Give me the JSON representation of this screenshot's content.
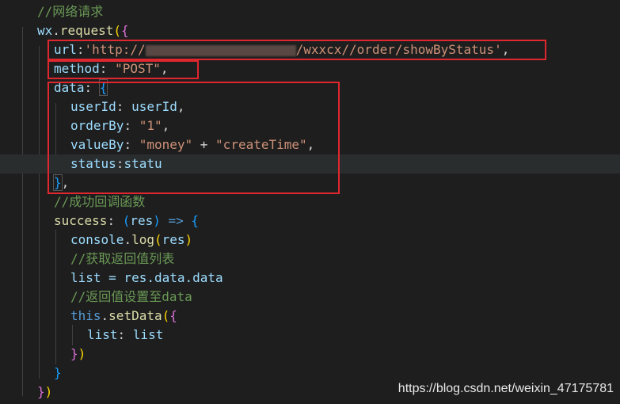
{
  "code": {
    "l1_comment": "//网络请求",
    "l2_obj": "wx",
    "l2_dot": ".",
    "l2_fn": "request",
    "l2_open": "(",
    "l2_brace": "{",
    "l3_key": "url",
    "l3_colon": ":",
    "l3_str_a": "'http://",
    "l3_str_b": "/wxxcx//order/showByStatus'",
    "l3_comma": ",",
    "l4_key": "method",
    "l4_colon": ": ",
    "l4_str": "\"POST\"",
    "l4_comma": ",",
    "l5_key": "data",
    "l5_colon": ": ",
    "l5_brace": "{",
    "l6_key": "userId",
    "l6_colon": ": ",
    "l6_val": "userId",
    "l6_comma": ",",
    "l7_key": "orderBy",
    "l7_colon": ": ",
    "l7_str": "\"1\"",
    "l7_comma": ",",
    "l8_key": "valueBy",
    "l8_colon": ": ",
    "l8_str_a": "\"money\"",
    "l8_plus": " + ",
    "l8_str_b": "\"createTime\"",
    "l8_comma": ",",
    "l9_key": "status",
    "l9_colon": ":",
    "l9_val": "statu",
    "l10_brace": "}",
    "l10_comma": ",",
    "l11_comment": "//成功回调函数",
    "l12_key": "success",
    "l12_colon": ": ",
    "l12_open": "(",
    "l12_param": "res",
    "l12_close": ")",
    "l12_arrow": " => ",
    "l12_brace": "{",
    "l13_obj": "console",
    "l13_dot": ".",
    "l13_fn": "log",
    "l13_open": "(",
    "l13_arg": "res",
    "l13_close": ")",
    "l14_comment": "//获取返回值列表",
    "l15_text": "list = res.data.data",
    "l16_comment": "//返回值设置至data",
    "l17_this": "this",
    "l17_dot": ".",
    "l17_fn": "setData",
    "l17_open": "(",
    "l17_brace": "{",
    "l18_key": "list",
    "l18_colon": ": ",
    "l18_val": "list",
    "l19_brace": "}",
    "l19_close": ")",
    "l20_brace": "}",
    "l21_brace": "}",
    "l21_close": ")"
  },
  "watermark": "https://blog.csdn.net/weixin_47175781",
  "colors": {
    "background": "#1e1e1e",
    "comment": "#6a9955",
    "string": "#ce9178",
    "identifier": "#9cdcfe",
    "function": "#dcdcaa",
    "highlight_box": "#e0262e"
  }
}
